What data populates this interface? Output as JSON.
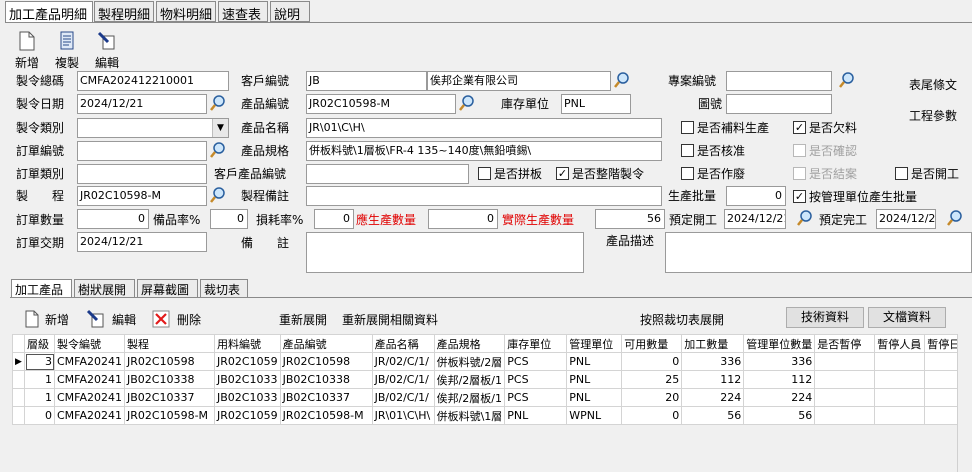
{
  "tabs": [
    "加工產品明細",
    "製程明細",
    "物料明細",
    "速查表",
    "說明"
  ],
  "toolbar": {
    "new": "新增",
    "copy": "複製",
    "edit": "編輯"
  },
  "side": {
    "tail_text": "表尾條文",
    "process_params": "工程參數"
  },
  "labels": {
    "order_total_no": "製令總碼",
    "customer_no": "客戶編號",
    "project_no": "專案編號",
    "order_date": "製令日期",
    "product_no": "產品編號",
    "stock_unit": "庫存單位",
    "drawing_no": "圖號",
    "order_type": "製令類別",
    "product_name": "產品名稱",
    "po_no": "訂單編號",
    "product_spec": "產品規格",
    "po_type": "訂單類別",
    "customer_product_no": "客戶產品編號",
    "process": "製　　程",
    "process_note": "製程備註",
    "batch": "生產批量",
    "order_qty": "訂單數量",
    "spare_rate": "備品率%",
    "loss_rate": "損耗率%",
    "should_qty": "應生產數量",
    "actual_qty": "實際生產數量",
    "plan_start": "預定開工",
    "plan_end": "預定完工",
    "po_delivery": "訂單交期",
    "remark": "備　　註",
    "product_desc": "產品描述"
  },
  "values": {
    "order_total_no": "CMFA202412210001",
    "customer_no": "JB",
    "customer_name": "俟邦企業有限公司",
    "project_no": "",
    "order_date": "2024/12/21",
    "product_no": "JR02C10598-M",
    "stock_unit": "PNL",
    "drawing_no": "",
    "order_type": "",
    "product_name": "JR\\01\\C\\H\\",
    "po_no": "",
    "product_spec": "併板料號\\1層板\\FR-4 135~140度\\無鉛噴錫\\",
    "po_type": "",
    "customer_product_no": "",
    "process": "JR02C10598-M",
    "process_note": "",
    "batch": "0",
    "order_qty": "0",
    "spare_rate": "0",
    "loss_rate": "0",
    "should_qty": "0",
    "actual_qty": "56",
    "plan_start": "2024/12/21",
    "plan_end": "2024/12/21",
    "po_delivery": "2024/12/21",
    "remark": "",
    "product_desc": ""
  },
  "checks": {
    "supplement": {
      "label": "是否補料生產",
      "checked": false,
      "disabled": false
    },
    "owe_material": {
      "label": "是否欠料",
      "checked": true,
      "disabled": false
    },
    "approved": {
      "label": "是否核准",
      "checked": false,
      "disabled": false
    },
    "confirmed": {
      "label": "是否確認",
      "checked": false,
      "disabled": true
    },
    "void": {
      "label": "是否作廢",
      "checked": false,
      "disabled": false
    },
    "closed": {
      "label": "是否結案",
      "checked": false,
      "disabled": true
    },
    "started": {
      "label": "是否開工",
      "checked": false,
      "disabled": false
    },
    "panel": {
      "label": "是否拼板",
      "checked": false,
      "disabled": false
    },
    "whole_order": {
      "label": "是否整階製令",
      "checked": true,
      "disabled": false
    },
    "by_mgmt_unit": {
      "label": "按管理單位產生批量",
      "checked": true,
      "disabled": false
    }
  },
  "subtabs": [
    "加工產品",
    "樹狀展開",
    "屏幕截圖",
    "裁切表"
  ],
  "grid_toolbar": {
    "add": "新增",
    "edit": "編輯",
    "delete": "刪除",
    "re_expand": "重新展開",
    "re_expand_related": "重新展開相關資料",
    "expand_by_cut": "按照裁切表展開",
    "tech_data": "技術資料",
    "doc_data": "文檔資料"
  },
  "grid": {
    "columns": [
      "層級",
      "製令編號",
      "製程",
      "用料編號",
      "產品編號",
      "產品名稱",
      "產品規格",
      "庫存單位",
      "管理單位",
      "可用數量",
      "加工數量",
      "管理單位數量",
      "是否暫停",
      "暫停人員",
      "暫停日"
    ],
    "rows": [
      [
        "3",
        "CMFA20241",
        "JR02C10598",
        "JR02C1059",
        "JR02C10598",
        "JR/02/C/1/",
        "併板料號/2層",
        "PCS",
        "PNL",
        "0",
        "336",
        "336",
        "",
        "",
        ""
      ],
      [
        "1",
        "CMFA20241",
        "JB02C10338",
        "JB02C1033",
        "JB02C10338",
        "JB/02/C/1/",
        "俟邦/2層板/1",
        "PCS",
        "PNL",
        "25",
        "112",
        "112",
        "",
        "",
        ""
      ],
      [
        "1",
        "CMFA20241",
        "JB02C10337",
        "JB02C1033",
        "JB02C10337",
        "JB/02/C/1/",
        "俟邦/2層板/1",
        "PCS",
        "PNL",
        "20",
        "224",
        "224",
        "",
        "",
        ""
      ],
      [
        "0",
        "CMFA20241",
        "JR02C10598-M",
        "JR02C1059",
        "JR02C10598-M",
        "JR\\01\\C\\H\\",
        "併板料號\\1層",
        "PNL",
        "WPNL",
        "0",
        "56",
        "56",
        "",
        "",
        ""
      ]
    ]
  }
}
